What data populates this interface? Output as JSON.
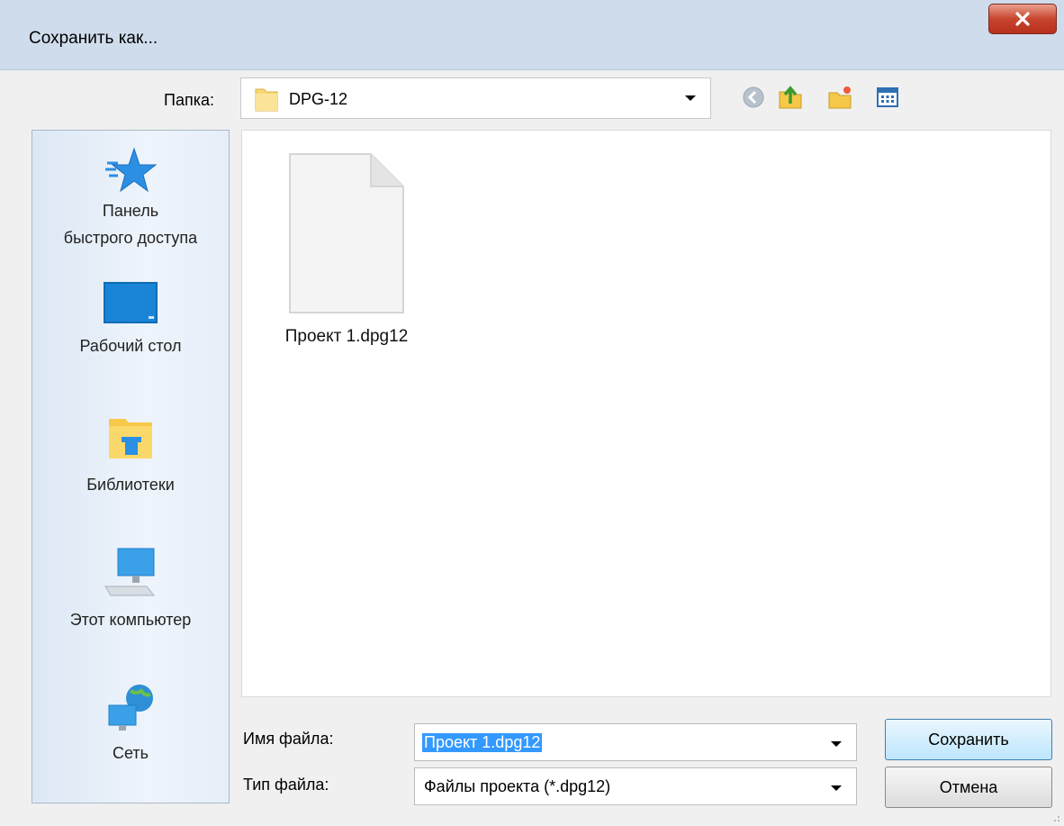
{
  "window": {
    "title": "Сохранить как...",
    "close_label": "x"
  },
  "lookin": {
    "label": "Папка:",
    "value": "DPG-12"
  },
  "toolbar": {
    "icons": [
      "back-icon",
      "up-folder-icon",
      "new-folder-icon",
      "view-menu-icon"
    ]
  },
  "places": [
    {
      "label_line1": "Панель",
      "label_line2": "быстрого доступа",
      "icon": "quick-access-star-icon"
    },
    {
      "label_line1": "Рабочий стол",
      "icon": "desktop-icon"
    },
    {
      "label_line1": "Библиотеки",
      "icon": "libraries-icon"
    },
    {
      "label_line1": "Этот компьютер",
      "icon": "computer-icon"
    },
    {
      "label_line1": "Сеть",
      "icon": "network-icon"
    }
  ],
  "files": [
    {
      "name": "Проект 1.dpg12",
      "icon": "document-icon"
    }
  ],
  "filename": {
    "label": "Имя файла:",
    "value": "Проект 1.dpg12"
  },
  "filetype": {
    "label": "Тип файла:",
    "value": "Файлы проекта (*.dpg12)"
  },
  "buttons": {
    "save": "Сохранить",
    "cancel": "Отмена"
  },
  "colors": {
    "selection": "#3399ff",
    "titlebar": "#cfdcec",
    "close_button": "#c8452f"
  }
}
